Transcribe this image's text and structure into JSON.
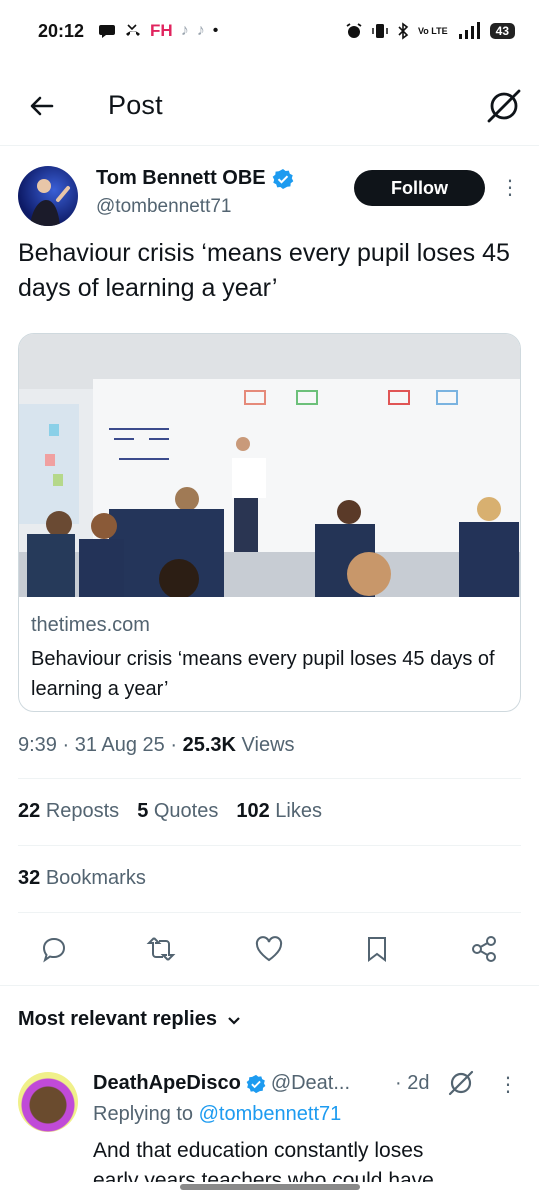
{
  "status_bar": {
    "time": "20:12",
    "left_icons": [
      "message-icon",
      "missed-call-icon",
      "FH",
      "tiktok-icon",
      "tiktok-icon",
      "dot"
    ],
    "app_badge": "FH",
    "network": "4G+",
    "volte": "Vo LTE",
    "battery": "43"
  },
  "header": {
    "title": "Post"
  },
  "post": {
    "author_name": "Tom Bennett OBE",
    "author_handle": "@tombennett71",
    "follow_label": "Follow",
    "text": "Behaviour crisis ‘means every pupil loses 45 days of learning a year’",
    "card_domain": "thetimes.com",
    "card_title": "Behaviour crisis ‘means every pupil loses 45 days of learning a year’",
    "time": "9:39",
    "date": "31 Aug 25",
    "views_count": "25.3K",
    "views_label": "Views"
  },
  "stats": {
    "reposts_count": "22",
    "reposts_label": "Reposts",
    "quotes_count": "5",
    "quotes_label": "Quotes",
    "likes_count": "102",
    "likes_label": "Likes",
    "bookmarks_count": "32",
    "bookmarks_label": "Bookmarks"
  },
  "replies": {
    "heading": "Most relevant replies",
    "first": {
      "name": "DeathApeDisco",
      "handle": "@Deat...",
      "time": "2d",
      "replying_prefix": "Replying to",
      "replying_to": "@tombennett71",
      "text_line1": "And that education constantly loses",
      "text_line2": "early years teachers who could have"
    }
  },
  "colors": {
    "accent": "#1d9bf0",
    "text": "#0f1419",
    "secondary": "#536471",
    "border": "#cfd9de"
  }
}
